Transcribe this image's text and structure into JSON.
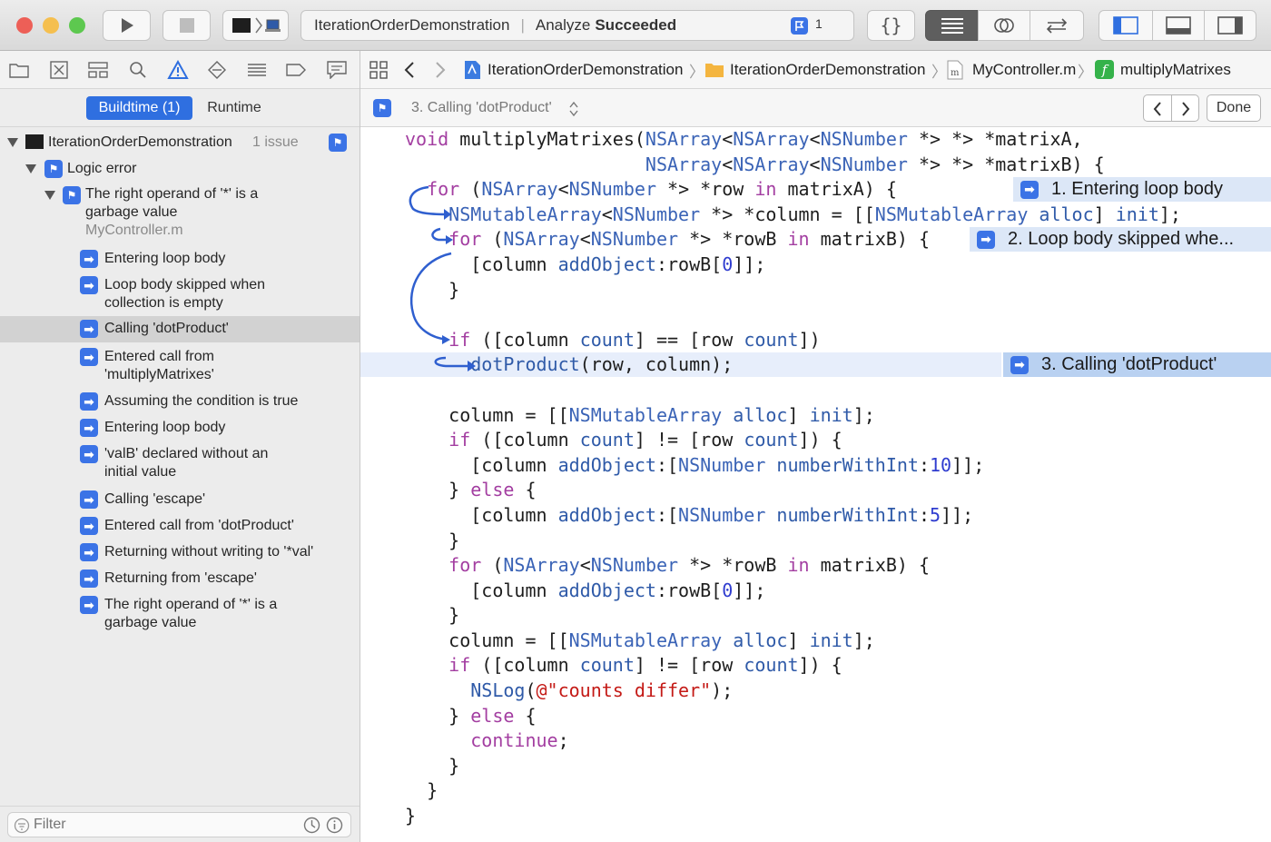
{
  "window": {
    "scheme": "IterationOrderDemonstration",
    "status_prefix": "Analyze",
    "status_strong": "Succeeded",
    "issue_count": "1"
  },
  "navigator": {
    "tabs": [
      "Buildtime (1)",
      "Runtime"
    ],
    "selected_tab": "Buildtime (1)",
    "project": {
      "name": "IterationOrderDemonstration",
      "issues": "1 issue"
    },
    "category": "Logic error",
    "issue": {
      "title_line1": "The right operand of '*' is a",
      "title_line2": "garbage value",
      "file": "MyController.m"
    },
    "steps": [
      {
        "line1": "Entering loop body",
        "line2": ""
      },
      {
        "line1": "Loop body skipped when",
        "line2": "collection is empty"
      },
      {
        "line1": "Calling 'dotProduct'",
        "line2": ""
      },
      {
        "line1": "Entered call from",
        "line2": "'multiplyMatrixes'"
      },
      {
        "line1": "Assuming the condition is true",
        "line2": ""
      },
      {
        "line1": "Entering loop body",
        "line2": ""
      },
      {
        "line1": "'valB' declared without an",
        "line2": "initial value"
      },
      {
        "line1": "Calling 'escape'",
        "line2": ""
      },
      {
        "line1": "Entered call from 'dotProduct'",
        "line2": ""
      },
      {
        "line1": "Returning without writing to '*val'",
        "line2": ""
      },
      {
        "line1": "Returning from 'escape'",
        "line2": ""
      },
      {
        "line1": "The right operand of '*' is a",
        "line2": "garbage value"
      }
    ],
    "selected_step": "Calling 'dotProduct'",
    "filter_placeholder": "Filter"
  },
  "jumpbar": {
    "crumbs": [
      "IterationOrderDemonstration",
      "IterationOrderDemonstration",
      "MyController.m",
      "multiplyMatrixes"
    ]
  },
  "issuebar": {
    "current_step": "3. Calling 'dotProduct'",
    "done_label": "Done"
  },
  "editor": {
    "bubbles": [
      "1. Entering loop body",
      "2. Loop body skipped whe...",
      "3. Calling 'dotProduct'"
    ]
  },
  "colors": {
    "accent": "#3b73e6",
    "keyword": "#a33ea1",
    "type": "#3a63b6",
    "number": "#2f3ccf",
    "string": "#c41a16",
    "highlight_line": "#e7eefb",
    "bubble": "#dce7f7"
  },
  "icons": [
    "play-icon",
    "stop-icon",
    "scheme-icon",
    "analyze-badge-icon",
    "braces-icon",
    "standard-editor-icon",
    "assistant-editor-icon",
    "version-editor-icon",
    "navigator-toggle-icon",
    "debug-area-toggle-icon",
    "inspector-toggle-icon",
    "folder-icon",
    "source-control-icon",
    "symbol-icon",
    "find-icon",
    "issue-icon",
    "test-icon",
    "debug-icon",
    "breakpoint-icon",
    "report-icon",
    "grid-icon",
    "back-arrow-icon",
    "forward-arrow-icon",
    "project-file-icon",
    "folder-icon",
    "m-file-icon",
    "function-icon",
    "filter-icon",
    "clock-icon",
    "info-icon"
  ]
}
